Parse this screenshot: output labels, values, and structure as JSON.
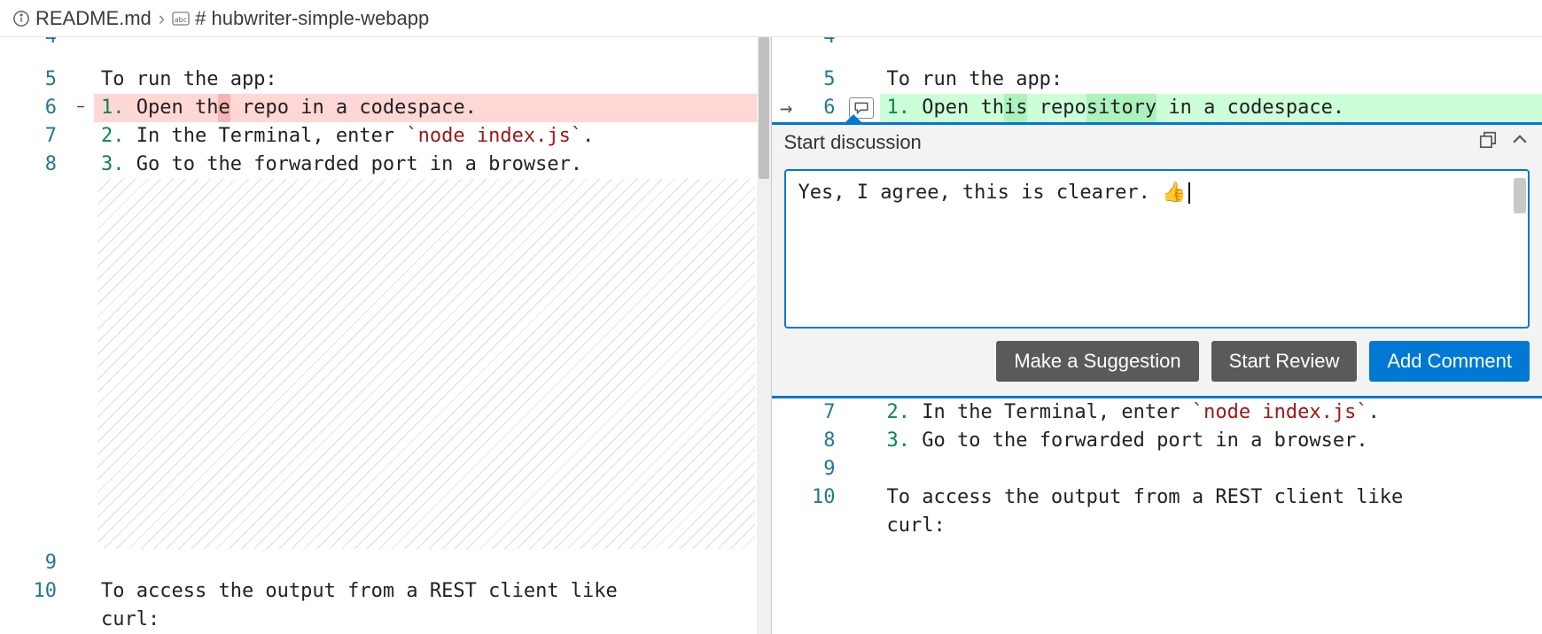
{
  "breadcrumb": {
    "file": "README.md",
    "section": "# hubwriter-simple-webapp"
  },
  "left": {
    "lines": [
      {
        "num": "4",
        "partial": true,
        "segments": []
      },
      {
        "num": "5",
        "segments": [
          {
            "t": "To run the app:",
            "c": "text"
          }
        ]
      },
      {
        "num": "6",
        "kind": "del",
        "segments": [
          {
            "t": "1.",
            "c": "num"
          },
          {
            "t": " Open th",
            "c": "text"
          },
          {
            "t": "e",
            "c": "text hl-del"
          },
          {
            "t": " repo",
            "c": "text"
          },
          {
            "t": " in a codespace.",
            "c": "text"
          }
        ]
      },
      {
        "num": "7",
        "segments": [
          {
            "t": "2.",
            "c": "num"
          },
          {
            "t": " In the Terminal, enter ",
            "c": "text"
          },
          {
            "t": "`node index.js`",
            "c": "literal"
          },
          {
            "t": ".",
            "c": "text"
          }
        ]
      },
      {
        "num": "8",
        "segments": [
          {
            "t": "3.",
            "c": "num"
          },
          {
            "t": " Go to the forwarded port in a browser.",
            "c": "text"
          }
        ]
      }
    ],
    "tail": [
      {
        "num": "9",
        "segments": []
      },
      {
        "num": "10",
        "segments": [
          {
            "t": "To access the output from a REST client like ",
            "c": "text"
          }
        ]
      },
      {
        "num": "",
        "segments": [
          {
            "t": "curl:",
            "c": "text"
          }
        ]
      }
    ]
  },
  "right": {
    "lines_before": [
      {
        "num": "4",
        "partial": true,
        "segments": []
      },
      {
        "num": "5",
        "segments": [
          {
            "t": "To run the app:",
            "c": "text"
          }
        ]
      },
      {
        "num": "6",
        "kind": "add",
        "hasArrow": true,
        "hasComment": true,
        "segments": [
          {
            "t": "1.",
            "c": "num"
          },
          {
            "t": " Open th",
            "c": "text"
          },
          {
            "t": "is",
            "c": "text hl-add"
          },
          {
            "t": " repo",
            "c": "text"
          },
          {
            "t": "sitory",
            "c": "text hl-add"
          },
          {
            "t": " in a codespace.",
            "c": "text"
          }
        ]
      }
    ],
    "lines_after": [
      {
        "num": "7",
        "segments": [
          {
            "t": "2.",
            "c": "num"
          },
          {
            "t": " In the Terminal, enter ",
            "c": "text"
          },
          {
            "t": "`node index.js`",
            "c": "literal"
          },
          {
            "t": ".",
            "c": "text"
          }
        ]
      },
      {
        "num": "8",
        "segments": [
          {
            "t": "3.",
            "c": "num"
          },
          {
            "t": " Go to the forwarded port in a browser.",
            "c": "text"
          }
        ]
      },
      {
        "num": "9",
        "segments": []
      },
      {
        "num": "10",
        "segments": [
          {
            "t": "To access the output from a REST client like ",
            "c": "text"
          }
        ]
      },
      {
        "num": "",
        "segments": [
          {
            "t": "curl:",
            "c": "text"
          }
        ]
      }
    ]
  },
  "discussion": {
    "title": "Start discussion",
    "comment": "Yes, I agree, this is clearer. 👍",
    "buttons": {
      "suggestion": "Make a Suggestion",
      "review": "Start Review",
      "add": "Add Comment"
    }
  }
}
